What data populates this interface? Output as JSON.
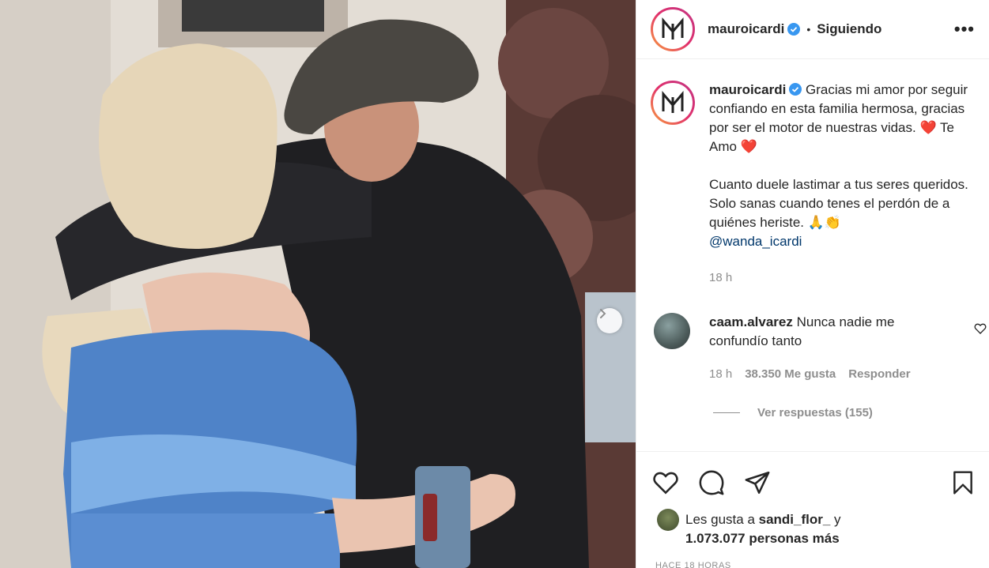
{
  "post": {
    "username": "mauroicardi",
    "follow_status": "Siguiendo",
    "more_label": "•••"
  },
  "caption": {
    "username": "mauroicardi",
    "line1": "Gracias mi amor por seguir confiando en esta familia hermosa, gracias por ser el motor de nuestras vidas. ",
    "heart1": "❤️",
    "te_amo": " Te Amo ",
    "heart2": "❤️",
    "line2": "Cuanto duele lastimar a tus seres queridos. Solo sanas cuando tenes el perdón de a quiénes heriste. ",
    "emojis": "🙏👏",
    "mention": "@wanda_icardi",
    "time": "18 h"
  },
  "comment": {
    "username": "caam.alvarez",
    "text": "Nunca nadie me confundío tanto",
    "time": "18 h",
    "likes": "38.350 Me gusta",
    "reply": "Responder",
    "view_replies": "Ver respuestas (155)"
  },
  "likes": {
    "prefix": "Les gusta a ",
    "user": "sandi_flor_",
    "suffix": " y",
    "others": "1.073.077 personas más"
  },
  "timestamp": "HACE 18 HORAS",
  "icons": {
    "like": "heart-icon",
    "comment": "comment-icon",
    "share": "paper-plane-icon",
    "save": "bookmark-icon",
    "next": "chevron-right-icon",
    "verified": "verified-badge-icon"
  },
  "colors": {
    "verified": "#3897f0",
    "link": "#00376b",
    "muted": "#8e8e8e",
    "text": "#262626"
  }
}
